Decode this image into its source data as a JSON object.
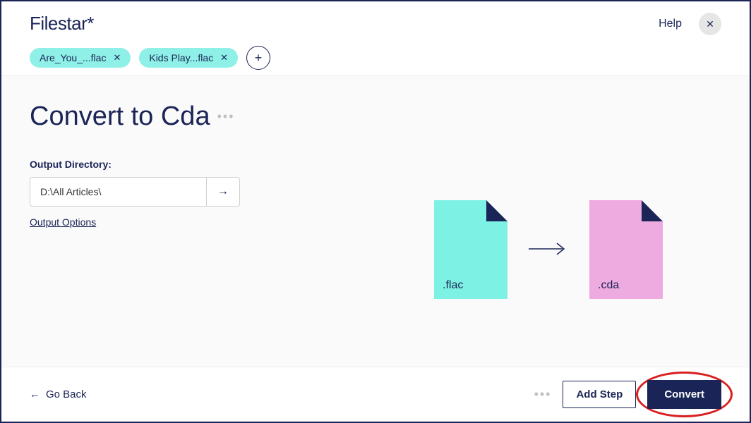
{
  "header": {
    "logo": "Filestar*",
    "help_label": "Help"
  },
  "files": [
    {
      "name": "Are_You_...flac"
    },
    {
      "name": "Kids Play...flac"
    }
  ],
  "page": {
    "title": "Convert to Cda",
    "output_directory_label": "Output Directory:",
    "output_directory_value": "D:\\All Articles\\",
    "output_options_label": "Output Options"
  },
  "conversion": {
    "source_ext": ".flac",
    "target_ext": ".cda"
  },
  "footer": {
    "go_back_label": "Go Back",
    "add_step_label": "Add Step",
    "convert_label": "Convert"
  }
}
